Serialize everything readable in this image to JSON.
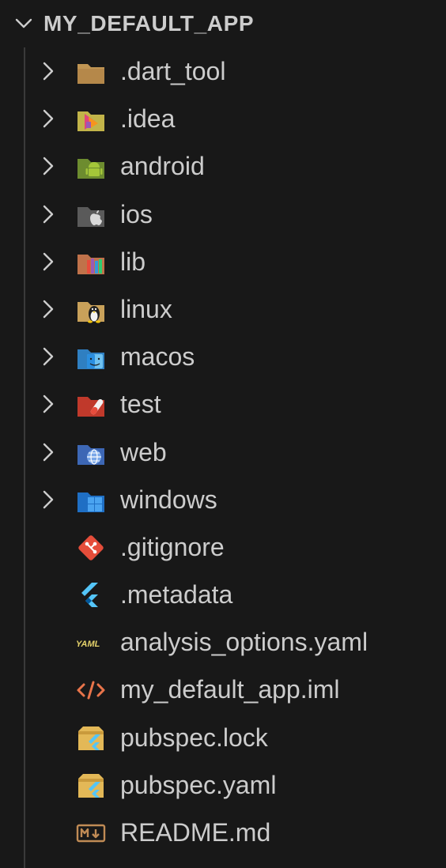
{
  "explorer": {
    "root_title": "MY_DEFAULT_APP",
    "root_icon": "chevron-down-icon",
    "folders": [
      {
        "label": ".dart_tool",
        "icon": "folder-dart-tool-icon"
      },
      {
        "label": ".idea",
        "icon": "folder-idea-icon"
      },
      {
        "label": "android",
        "icon": "folder-android-icon"
      },
      {
        "label": "ios",
        "icon": "folder-ios-icon"
      },
      {
        "label": "lib",
        "icon": "folder-lib-icon"
      },
      {
        "label": "linux",
        "icon": "folder-linux-icon"
      },
      {
        "label": "macos",
        "icon": "folder-macos-icon"
      },
      {
        "label": "test",
        "icon": "folder-test-icon"
      },
      {
        "label": "web",
        "icon": "folder-web-icon"
      },
      {
        "label": "windows",
        "icon": "folder-windows-icon"
      }
    ],
    "files": [
      {
        "label": ".gitignore",
        "icon": "git-icon"
      },
      {
        "label": ".metadata",
        "icon": "flutter-icon"
      },
      {
        "label": "analysis_options.yaml",
        "icon": "yaml-icon"
      },
      {
        "label": "my_default_app.iml",
        "icon": "code-tag-icon"
      },
      {
        "label": "pubspec.lock",
        "icon": "pubspec-icon"
      },
      {
        "label": "pubspec.yaml",
        "icon": "pubspec-icon"
      },
      {
        "label": "README.md",
        "icon": "markdown-icon"
      }
    ]
  },
  "colors": {
    "background": "#181818",
    "text": "#cccccc",
    "indent_guide": "#3a3a3a"
  }
}
